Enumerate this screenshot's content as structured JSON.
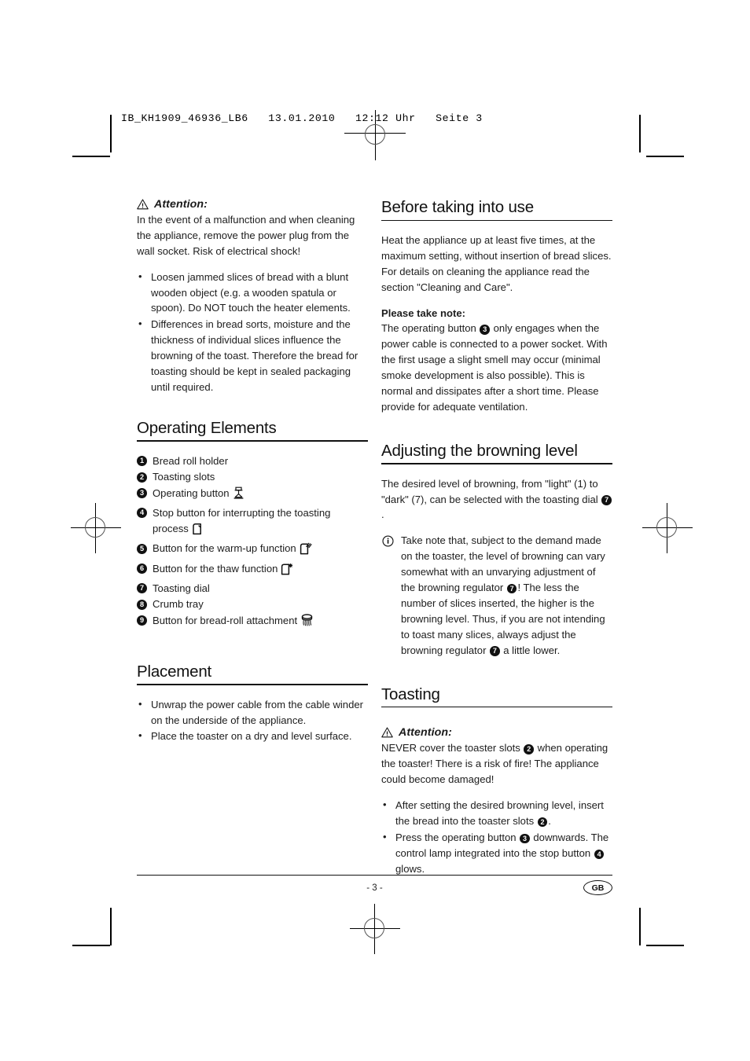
{
  "print_marks": {
    "slug_line": "IB_KH1909_46936_LB6   13.01.2010   12:12 Uhr   Seite 3"
  },
  "left_column": {
    "attention": {
      "label": "Attention:",
      "icon": "warning-triangle-icon",
      "body": "In the event of a malfunction and when cleaning the appliance, remove the power plug from the wall socket. Risk of electrical shock!",
      "bullets": [
        "Loosen jammed slices of bread with a blunt wooden object (e.g. a wooden spatula or spoon). Do NOT touch the heater elements.",
        "Differences in bread sorts, moisture and the thickness of individual slices influence the browning of the toast. Therefore the bread for toasting should be kept in sealed packaging until required."
      ]
    },
    "operating_elements": {
      "title": "Operating Elements",
      "items": [
        {
          "number": "1",
          "label": "Bread roll holder",
          "icon": ""
        },
        {
          "number": "2",
          "label": "Toasting slots",
          "icon": ""
        },
        {
          "number": "3",
          "label": "Operating button",
          "icon": "operating-lever-icon"
        },
        {
          "number": "4",
          "label": "Stop button for interrupting the toasting process",
          "icon": "bread-slice-icon"
        },
        {
          "number": "5",
          "label": "Button for the warm-up function",
          "icon": "bread-slice-warmup-icon"
        },
        {
          "number": "6",
          "label": "Button for the thaw function",
          "icon": "bread-slice-thaw-icon"
        },
        {
          "number": "7",
          "label": "Toasting dial",
          "icon": ""
        },
        {
          "number": "8",
          "label": "Crumb tray",
          "icon": ""
        },
        {
          "number": "9",
          "label": "Button for bread-roll attachment",
          "icon": "bread-roll-rack-icon"
        }
      ]
    },
    "placement": {
      "title": "Placement",
      "bullets": [
        "Unwrap the power cable from the cable winder on the underside of the appliance.",
        "Place the toaster on a dry and level surface."
      ]
    }
  },
  "right_column": {
    "before_use": {
      "title": "Before taking into use",
      "body": "Heat the appliance up at least five times, at the maximum setting, without insertion of bread slices. For details on cleaning the appliance read the section \"Cleaning and Care\".",
      "note_heading": "Please take note:",
      "note_part1": "The operating button",
      "note_badge": "3",
      "note_part2": "only engages when the power cable is connected to a power socket. With the first usage a slight smell may occur (minimal smoke development is also possible). This is normal and dissipates after a short time. Please provide for adequate ventilation."
    },
    "browning_level": {
      "title": "Adjusting the browning level",
      "intro_part1": "The desired level of browning, from \"light\" (1) to \"dark\" (7), can be selected with the toasting dial",
      "intro_badge": "7",
      "intro_part2": ".",
      "note_icon": "info-icon",
      "note_part1": "Take note that, subject to the demand made on the toaster, the level of browning can vary somewhat with an unvarying adjustment of the browning regulator",
      "note_badge1": "7",
      "note_part2": "! The less the number of slices inserted, the higher is the browning level. Thus, if you are not intending to toast many slices, always adjust the browning regulator",
      "note_badge2": "7",
      "note_part3": "a little lower."
    },
    "toasting": {
      "title": "Toasting",
      "attention_label": "Attention:",
      "attention_icon": "warning-triangle-icon",
      "attention_part1": "NEVER cover the toaster slots",
      "attention_badge": "2",
      "attention_part2": "when operating the toaster! There is a risk of fire! The appliance could become damaged!",
      "bullets": [
        {
          "part1": "After setting the desired browning level, insert the bread into the toaster slots",
          "badge1": "2",
          "part2": ".",
          "badge2": "",
          "part3": ""
        },
        {
          "part1": "Press the operating button",
          "badge1": "3",
          "part2": "downwards. The control lamp integrated into the stop button",
          "badge2": "4",
          "part3": "glows."
        }
      ]
    }
  },
  "footer": {
    "page_number": "- 3 -",
    "language_badge": "GB"
  }
}
